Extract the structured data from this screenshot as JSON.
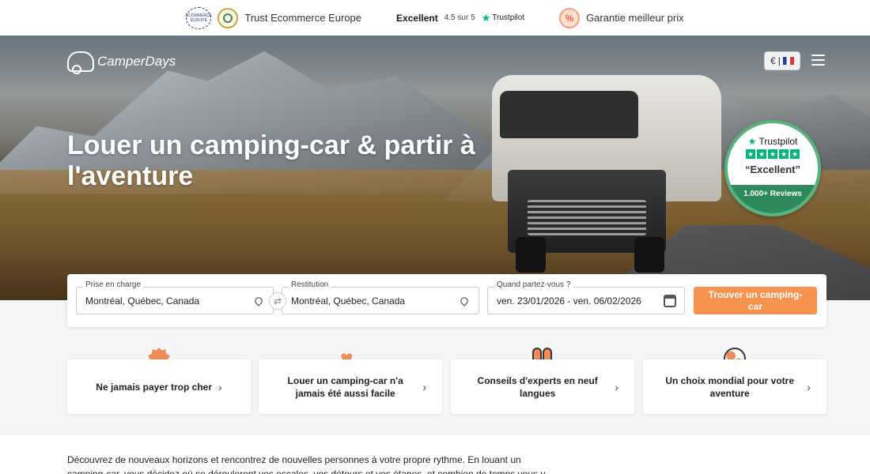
{
  "trustbar": {
    "eu_badge_text": "ECOMMERCE EUROPE",
    "trust_label": "Trust Ecommerce Europe",
    "tp_excellent": "Excellent",
    "tp_score": "4.5 sur 5",
    "tp_brand": "Trustpilot",
    "price_label": "Garantie meilleur prix"
  },
  "header": {
    "logo_text": "CamperDays",
    "currency": "€",
    "separator": "|",
    "menu_icon": "hamburger-icon"
  },
  "hero": {
    "title": "Louer un camping-car & partir à l'aventure"
  },
  "tp_badge": {
    "brand": "Trustpilot",
    "rating_word": "“Excellent”",
    "reviews": "1.000+ Reviews",
    "stars": 5
  },
  "search": {
    "pickup_label": "Prise en charge",
    "pickup_value": "Montréal, Québec, Canada",
    "return_label": "Restitution",
    "return_value": "Montréal, Québec, Canada",
    "dates_label": "Quand partez-vous ?",
    "dates_value": "ven. 23/01/2026 - ven. 06/02/2026",
    "cta": "Trouver un camping-car"
  },
  "features": [
    {
      "label": "Ne jamais payer trop cher",
      "icon": "discount-badge-icon"
    },
    {
      "label": "Louer un camping-car n'a jamais été aussi facile",
      "icon": "heart-icon"
    },
    {
      "label": "Conseils d'experts en neuf langues",
      "icon": "people-icon"
    },
    {
      "label": "Un choix mondial pour votre aventure",
      "icon": "globe-icon"
    }
  ],
  "intro": {
    "text": "Découvrez de nouveaux horizons et rencontrez de nouvelles personnes à votre propre rythme. En louant un camping-car, vous décidez où se dérouleront vos escales, vos détours et vos étapes, et combien de temps vous y resterez."
  },
  "colors": {
    "accent": "#f7924f",
    "trustpilot_green": "#00b67a"
  }
}
